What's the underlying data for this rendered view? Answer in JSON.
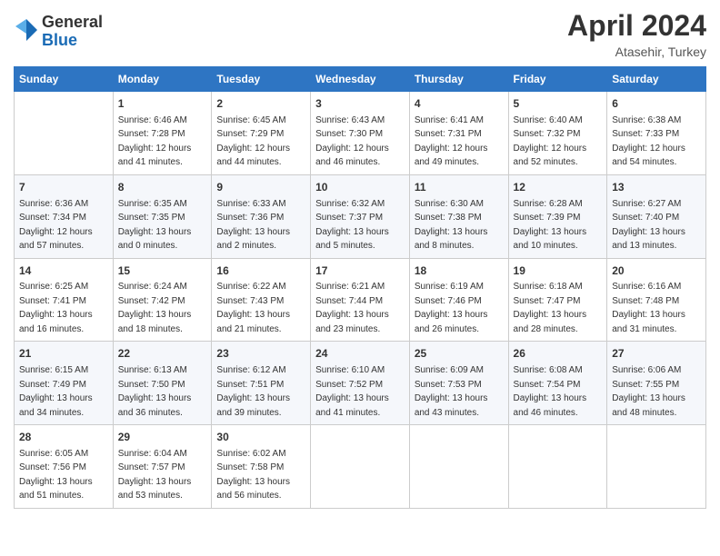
{
  "logo": {
    "general": "General",
    "blue": "Blue"
  },
  "title": {
    "month": "April 2024",
    "location": "Atasehir, Turkey"
  },
  "headers": [
    "Sunday",
    "Monday",
    "Tuesday",
    "Wednesday",
    "Thursday",
    "Friday",
    "Saturday"
  ],
  "weeks": [
    [
      {
        "day": "",
        "info": ""
      },
      {
        "day": "1",
        "info": "Sunrise: 6:46 AM\nSunset: 7:28 PM\nDaylight: 12 hours\nand 41 minutes."
      },
      {
        "day": "2",
        "info": "Sunrise: 6:45 AM\nSunset: 7:29 PM\nDaylight: 12 hours\nand 44 minutes."
      },
      {
        "day": "3",
        "info": "Sunrise: 6:43 AM\nSunset: 7:30 PM\nDaylight: 12 hours\nand 46 minutes."
      },
      {
        "day": "4",
        "info": "Sunrise: 6:41 AM\nSunset: 7:31 PM\nDaylight: 12 hours\nand 49 minutes."
      },
      {
        "day": "5",
        "info": "Sunrise: 6:40 AM\nSunset: 7:32 PM\nDaylight: 12 hours\nand 52 minutes."
      },
      {
        "day": "6",
        "info": "Sunrise: 6:38 AM\nSunset: 7:33 PM\nDaylight: 12 hours\nand 54 minutes."
      }
    ],
    [
      {
        "day": "7",
        "info": "Sunrise: 6:36 AM\nSunset: 7:34 PM\nDaylight: 12 hours\nand 57 minutes."
      },
      {
        "day": "8",
        "info": "Sunrise: 6:35 AM\nSunset: 7:35 PM\nDaylight: 13 hours\nand 0 minutes."
      },
      {
        "day": "9",
        "info": "Sunrise: 6:33 AM\nSunset: 7:36 PM\nDaylight: 13 hours\nand 2 minutes."
      },
      {
        "day": "10",
        "info": "Sunrise: 6:32 AM\nSunset: 7:37 PM\nDaylight: 13 hours\nand 5 minutes."
      },
      {
        "day": "11",
        "info": "Sunrise: 6:30 AM\nSunset: 7:38 PM\nDaylight: 13 hours\nand 8 minutes."
      },
      {
        "day": "12",
        "info": "Sunrise: 6:28 AM\nSunset: 7:39 PM\nDaylight: 13 hours\nand 10 minutes."
      },
      {
        "day": "13",
        "info": "Sunrise: 6:27 AM\nSunset: 7:40 PM\nDaylight: 13 hours\nand 13 minutes."
      }
    ],
    [
      {
        "day": "14",
        "info": "Sunrise: 6:25 AM\nSunset: 7:41 PM\nDaylight: 13 hours\nand 16 minutes."
      },
      {
        "day": "15",
        "info": "Sunrise: 6:24 AM\nSunset: 7:42 PM\nDaylight: 13 hours\nand 18 minutes."
      },
      {
        "day": "16",
        "info": "Sunrise: 6:22 AM\nSunset: 7:43 PM\nDaylight: 13 hours\nand 21 minutes."
      },
      {
        "day": "17",
        "info": "Sunrise: 6:21 AM\nSunset: 7:44 PM\nDaylight: 13 hours\nand 23 minutes."
      },
      {
        "day": "18",
        "info": "Sunrise: 6:19 AM\nSunset: 7:46 PM\nDaylight: 13 hours\nand 26 minutes."
      },
      {
        "day": "19",
        "info": "Sunrise: 6:18 AM\nSunset: 7:47 PM\nDaylight: 13 hours\nand 28 minutes."
      },
      {
        "day": "20",
        "info": "Sunrise: 6:16 AM\nSunset: 7:48 PM\nDaylight: 13 hours\nand 31 minutes."
      }
    ],
    [
      {
        "day": "21",
        "info": "Sunrise: 6:15 AM\nSunset: 7:49 PM\nDaylight: 13 hours\nand 34 minutes."
      },
      {
        "day": "22",
        "info": "Sunrise: 6:13 AM\nSunset: 7:50 PM\nDaylight: 13 hours\nand 36 minutes."
      },
      {
        "day": "23",
        "info": "Sunrise: 6:12 AM\nSunset: 7:51 PM\nDaylight: 13 hours\nand 39 minutes."
      },
      {
        "day": "24",
        "info": "Sunrise: 6:10 AM\nSunset: 7:52 PM\nDaylight: 13 hours\nand 41 minutes."
      },
      {
        "day": "25",
        "info": "Sunrise: 6:09 AM\nSunset: 7:53 PM\nDaylight: 13 hours\nand 43 minutes."
      },
      {
        "day": "26",
        "info": "Sunrise: 6:08 AM\nSunset: 7:54 PM\nDaylight: 13 hours\nand 46 minutes."
      },
      {
        "day": "27",
        "info": "Sunrise: 6:06 AM\nSunset: 7:55 PM\nDaylight: 13 hours\nand 48 minutes."
      }
    ],
    [
      {
        "day": "28",
        "info": "Sunrise: 6:05 AM\nSunset: 7:56 PM\nDaylight: 13 hours\nand 51 minutes."
      },
      {
        "day": "29",
        "info": "Sunrise: 6:04 AM\nSunset: 7:57 PM\nDaylight: 13 hours\nand 53 minutes."
      },
      {
        "day": "30",
        "info": "Sunrise: 6:02 AM\nSunset: 7:58 PM\nDaylight: 13 hours\nand 56 minutes."
      },
      {
        "day": "",
        "info": ""
      },
      {
        "day": "",
        "info": ""
      },
      {
        "day": "",
        "info": ""
      },
      {
        "day": "",
        "info": ""
      }
    ]
  ]
}
